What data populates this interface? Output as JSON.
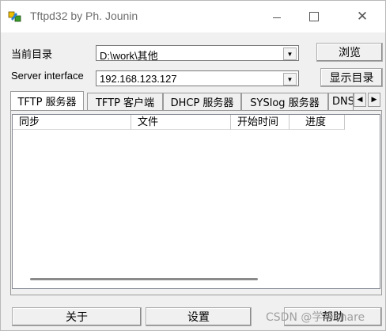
{
  "window": {
    "title": "Tftpd32 by Ph. Jounin",
    "controls": {
      "minimize": "—",
      "maximize": "□",
      "close": "✕"
    }
  },
  "current_dir": {
    "label": "当前目录",
    "value": "D:\\work\\其他",
    "browse_button": "浏览"
  },
  "server_interface": {
    "label": "Server interface",
    "value": "192.168.123.127",
    "show_dir_button": "显示目录"
  },
  "tabs": [
    {
      "label": "TFTP 服务器",
      "active": true
    },
    {
      "label": "TFTP 客户端",
      "active": false
    },
    {
      "label": "DHCP 服务器",
      "active": false
    },
    {
      "label": "SYSlog 服务器",
      "active": false
    },
    {
      "label": "DNS",
      "active": false
    }
  ],
  "tab_scroll": {
    "left": "◀",
    "right": "▶"
  },
  "list_columns": [
    "同步",
    "文件",
    "开始时间",
    "进度"
  ],
  "bottom_buttons": {
    "about": "关于",
    "settings": "设置",
    "help": "帮助"
  },
  "watermark": "CSDN @学与share"
}
